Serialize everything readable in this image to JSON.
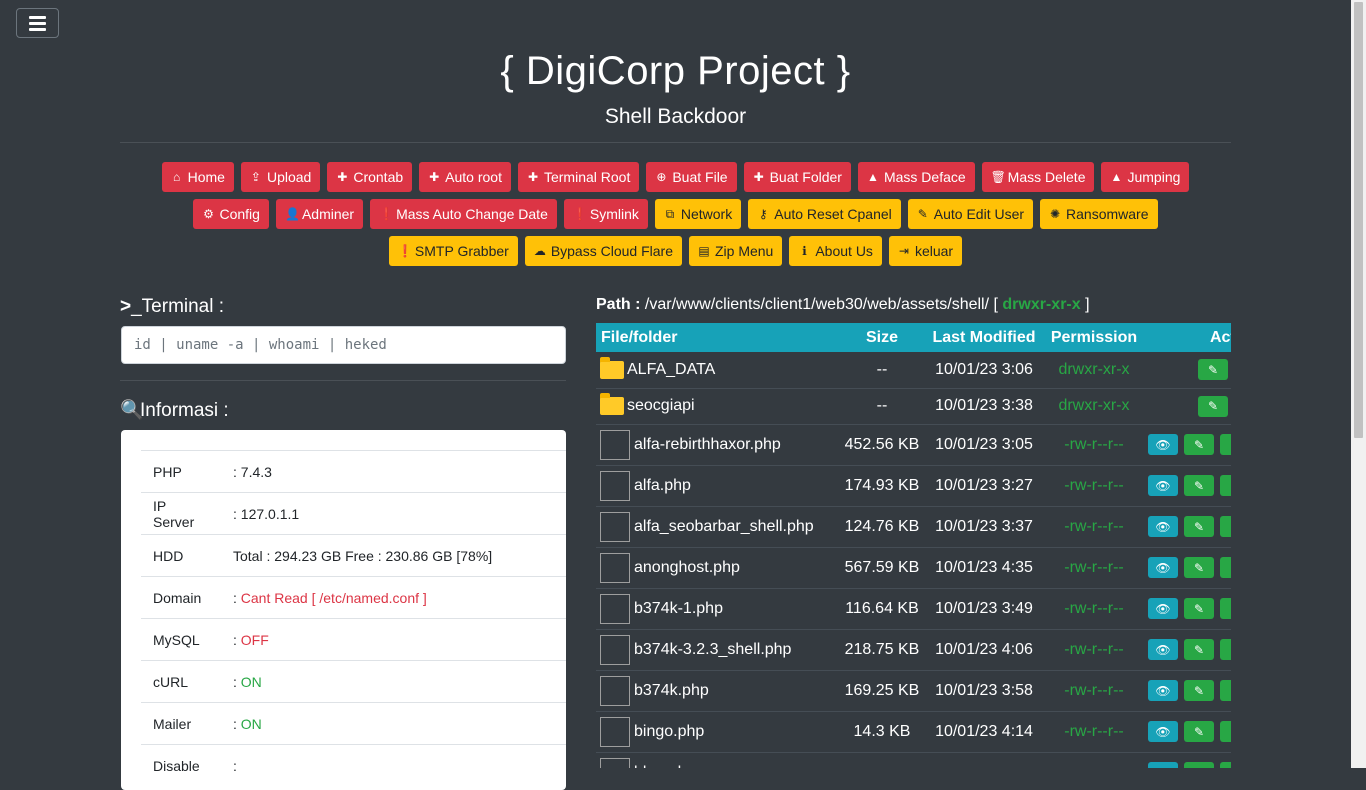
{
  "header": {
    "title": "{ DigiCorp Project }",
    "subtitle": "Shell Backdoor"
  },
  "nav": {
    "row1": [
      {
        "label": "Home",
        "icon": "home-icon",
        "glyph": "⌂"
      },
      {
        "label": "Upload",
        "icon": "upload-icon",
        "glyph": "⇪"
      },
      {
        "label": "Crontab",
        "icon": "plus-icon",
        "glyph": "✚"
      },
      {
        "label": "Auto root",
        "icon": "plus-icon",
        "glyph": "✚"
      },
      {
        "label": "Terminal Root",
        "icon": "plus-icon",
        "glyph": "✚"
      },
      {
        "label": "Buat File",
        "icon": "plus-circle-icon",
        "glyph": "⊕"
      },
      {
        "label": "Buat Folder",
        "icon": "plus-icon",
        "glyph": "✚"
      },
      {
        "label": "Mass Deface",
        "icon": "warning-icon",
        "glyph": "▲"
      },
      {
        "label": "Mass Delete",
        "icon": "trash-icon",
        "glyph": "🗑"
      },
      {
        "label": "Jumping",
        "icon": "warning-icon",
        "glyph": "▲"
      }
    ],
    "row2": [
      {
        "label": "Config",
        "icon": "cogs-icon",
        "glyph": "⚙",
        "color": "red"
      },
      {
        "label": "Adminer",
        "icon": "user-icon",
        "glyph": "👤",
        "color": "red"
      },
      {
        "label": "Mass Auto Change Date",
        "icon": "exclamation-circle-icon",
        "glyph": "❗",
        "color": "red"
      },
      {
        "label": "Symlink",
        "icon": "exclamation-circle-icon",
        "glyph": "❗",
        "color": "red"
      },
      {
        "label": "Network",
        "icon": "network-icon",
        "glyph": "⧉",
        "color": "yellow"
      },
      {
        "label": "Auto Reset Cpanel",
        "icon": "key-icon",
        "glyph": "⚷",
        "color": "yellow"
      },
      {
        "label": "Auto Edit User",
        "icon": "user-edit-icon",
        "glyph": "✎",
        "color": "yellow"
      },
      {
        "label": "Ransomware",
        "icon": "bug-icon",
        "glyph": "✺",
        "color": "yellow"
      }
    ],
    "row3": [
      {
        "label": "SMTP Grabber",
        "icon": "exclamation-circle-icon",
        "glyph": "❗"
      },
      {
        "label": "Bypass Cloud Flare",
        "icon": "cloud-icon",
        "glyph": "☁"
      },
      {
        "label": "Zip Menu",
        "icon": "file-zip-icon",
        "glyph": "▤"
      },
      {
        "label": "About Us",
        "icon": "info-icon",
        "glyph": "ℹ"
      },
      {
        "label": "keluar",
        "icon": "sign-out-icon",
        "glyph": "⇥"
      }
    ]
  },
  "terminal": {
    "title": "_Terminal :",
    "prompt": ">",
    "placeholder": "id | uname -a | whoami | heked"
  },
  "info": {
    "title": "Informasi :",
    "rows": [
      {
        "key": "PHP",
        "value": ": 7.4.3",
        "style": ""
      },
      {
        "key": "IP Server",
        "value": ": 127.0.1.1",
        "style": ""
      },
      {
        "key": "HDD",
        "value": "Total : 294.23 GB Free : 230.86 GB [78%]",
        "style": ""
      },
      {
        "key": "Domain",
        "prefix": ": ",
        "value": "Cant Read [ /etc/named.conf ]",
        "style": "red"
      },
      {
        "key": "MySQL",
        "prefix": ": ",
        "value": "OFF",
        "style": "red"
      },
      {
        "key": "cURL",
        "prefix": ": ",
        "value": "ON",
        "style": "green"
      },
      {
        "key": "Mailer",
        "prefix": ": ",
        "value": "ON",
        "style": "green"
      },
      {
        "key": "Disable",
        "value": ":",
        "style": ""
      }
    ]
  },
  "path": {
    "label": "Path :",
    "value": "/var/www/clients/client1/web30/web/assets/shell/",
    "perm": "drwxr-xr-x"
  },
  "files": {
    "headers": [
      "File/folder",
      "Size",
      "Last Modified",
      "Permission",
      "Action"
    ],
    "dirs": [
      {
        "name": "ALFA_DATA",
        "size": "--",
        "modified": "10/01/23 3:06",
        "perm": "drwxr-xr-x"
      },
      {
        "name": "seocgiapi",
        "size": "--",
        "modified": "10/01/23 3:38",
        "perm": "drwxr-xr-x"
      }
    ],
    "items": [
      {
        "name": "alfa-rebirthhaxor.php",
        "size": "452.56 KB",
        "modified": "10/01/23 3:05",
        "perm": "-rw-r--r--"
      },
      {
        "name": "alfa.php",
        "size": "174.93 KB",
        "modified": "10/01/23 3:27",
        "perm": "-rw-r--r--"
      },
      {
        "name": "alfa_seobarbar_shell.php",
        "size": "124.76 KB",
        "modified": "10/01/23 3:37",
        "perm": "-rw-r--r--"
      },
      {
        "name": "anonghost.php",
        "size": "567.59 KB",
        "modified": "10/01/23 4:35",
        "perm": "-rw-r--r--"
      },
      {
        "name": "b374k-1.php",
        "size": "116.64 KB",
        "modified": "10/01/23 3:49",
        "perm": "-rw-r--r--"
      },
      {
        "name": "b374k-3.2.3_shell.php",
        "size": "218.75 KB",
        "modified": "10/01/23 4:06",
        "perm": "-rw-r--r--"
      },
      {
        "name": "b374k.php",
        "size": "169.25 KB",
        "modified": "10/01/23 3:58",
        "perm": "-rw-r--r--"
      },
      {
        "name": "bingo.php",
        "size": "14.3 KB",
        "modified": "10/01/23 4:14",
        "perm": "-rw-r--r--"
      },
      {
        "name": "blue.php",
        "size": "",
        "modified": "",
        "perm": ""
      }
    ]
  },
  "colors": {
    "bg": "#343a40",
    "red": "#dc3545",
    "yellow": "#ffc107",
    "teal": "#17a2b8",
    "green": "#28a745"
  }
}
